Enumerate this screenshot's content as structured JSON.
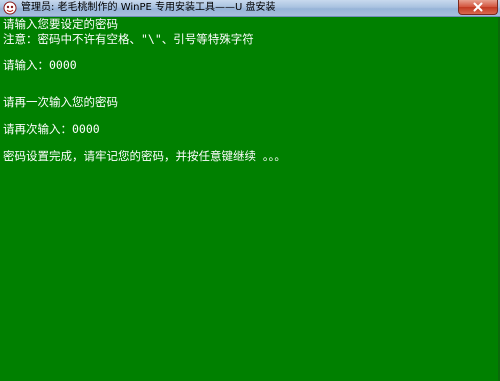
{
  "window": {
    "title": "管理员: 老毛桃制作的 WinPE 专用安装工具——U 盘安装"
  },
  "icons": {
    "app": "console-app-icon",
    "close": "close-icon"
  },
  "colors": {
    "console_background": "#008000",
    "console_text": "#ffffff"
  },
  "console": {
    "lines": [
      "请输入您要设定的密码",
      "注意：密码中不许有空格、\"\\\"、引号等特殊字符",
      "请输入：0000",
      "请再一次输入您的密码",
      "请再次输入：0000",
      "密码设置完成，请牢记您的密码，并按任意键继续 。。。"
    ]
  }
}
